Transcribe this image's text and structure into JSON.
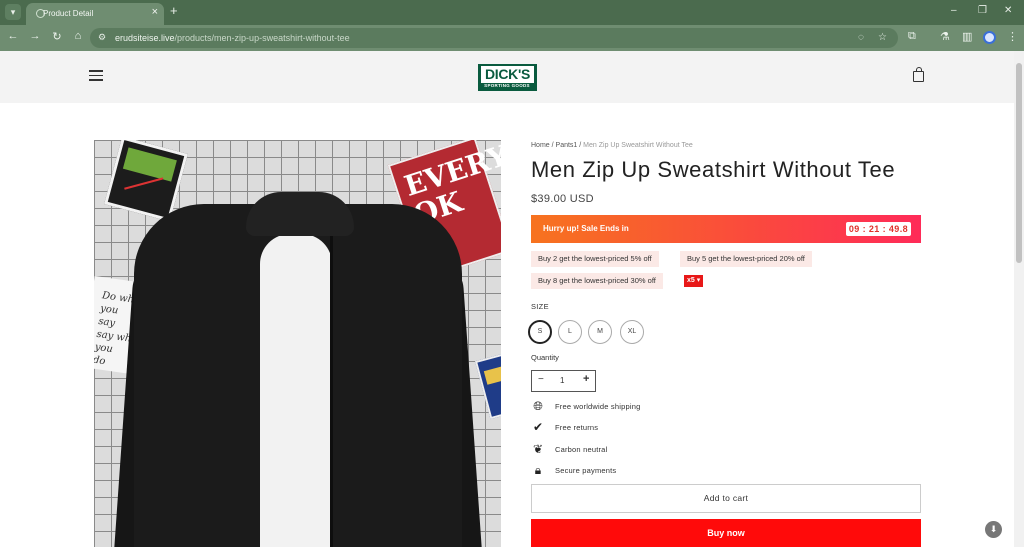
{
  "browser": {
    "tab_menu_icon": "chevron-down-icon",
    "tab_title": "Product Detail",
    "tab_close": "×",
    "new_tab": "+",
    "window_controls": [
      "–",
      "❐",
      "✕"
    ],
    "url_host": "erudsiteise.live",
    "url_path": "/products/men-zip-up-sweatshirt-without-tee"
  },
  "store": {
    "logo_text": "DICK'S",
    "logo_subtext": "SPORTING GOODS"
  },
  "product": {
    "breadcrumb": {
      "home": "Home",
      "sep1": " / ",
      "category": "Pants1",
      "sep2": " / ",
      "current": "Men Zip Up Sweatshirt Without Tee"
    },
    "title": "Men Zip Up Sweatshirt Without Tee",
    "price": "$39.00 USD",
    "sale": {
      "label": "Hurry up! Sale Ends in",
      "timer": "09 : 21 : 49.8"
    },
    "offers": [
      "Buy 2 get the lowest-priced 5% off",
      "Buy 5 get the lowest-priced 20% off",
      "Buy 8 get the lowest-priced 30% off"
    ],
    "offer_count": "x5 ▾",
    "size_label": "SIZE",
    "sizes": [
      "S",
      "L",
      "M",
      "XL"
    ],
    "selected_size": "S",
    "quantity_label": "Quantity",
    "quantity": "1",
    "features": [
      {
        "icon": "globe-icon",
        "text": "Free worldwide shipping"
      },
      {
        "icon": "check-circle-icon",
        "text": "Free returns"
      },
      {
        "icon": "leaf-icon",
        "text": "Carbon neutral"
      },
      {
        "icon": "lock-icon",
        "text": "Secure payments"
      }
    ],
    "add_to_cart": "Add to cart",
    "buy_now": "Buy now"
  },
  "image_text": {
    "red_card": "EVERY\nOK",
    "note_card": "Do what you say\nsay what you do"
  },
  "colors": {
    "brand_green": "#0a5b3f",
    "buy_now_red": "#ff0a0a",
    "sale_gradient_start": "#f7731f",
    "sale_gradient_end": "#ff2b58"
  }
}
